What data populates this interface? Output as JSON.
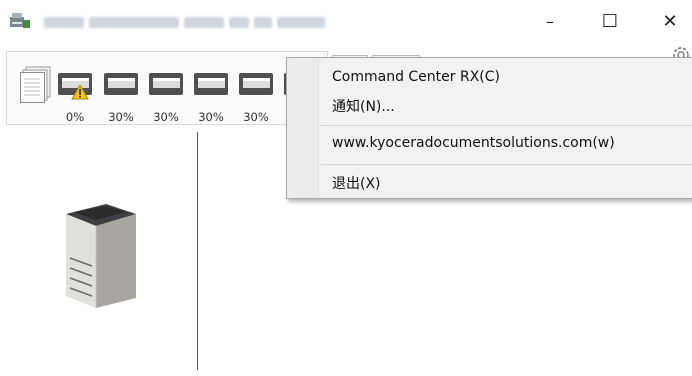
{
  "window": {
    "icons": {
      "app": "printer-app-icon",
      "minimize": "minimize-icon",
      "maximize": "maximize-icon",
      "close": "close-icon"
    },
    "minimize_glyph": "–",
    "maximize_glyph": "☐",
    "close_glyph": "✕"
  },
  "toolbar": {
    "trays": [
      {
        "level": "0%",
        "warning": true
      },
      {
        "level": "30%",
        "warning": false
      },
      {
        "level": "30%",
        "warning": false
      },
      {
        "level": "30%",
        "warning": false
      },
      {
        "level": "30%",
        "warning": false
      }
    ],
    "icons": {
      "document_stack": "document-stack-icon",
      "tray": "paper-tray-icon",
      "warning": "warning-icon",
      "settings": "gear-icon"
    }
  },
  "context_menu": {
    "items": [
      {
        "label": "Command Center RX(C)"
      },
      {
        "label": "通知(N)..."
      },
      {
        "label": "www.kyoceradocumentsolutions.com(w)"
      },
      {
        "label": "退出(X)"
      }
    ]
  },
  "colors": {
    "menu_bg": "#f2f2f2",
    "warning": "#f5c400",
    "divider": "#5a5a5a"
  }
}
